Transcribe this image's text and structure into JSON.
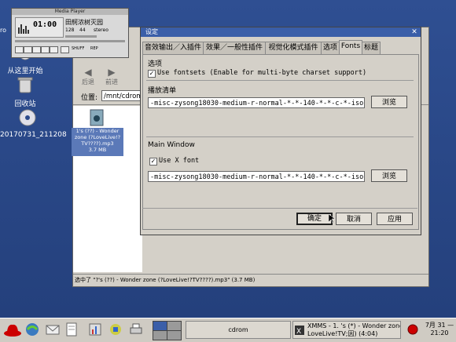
{
  "desktop": {
    "icons": [
      {
        "label": "从这里开始"
      },
      {
        "label": "回收站"
      },
      {
        "label": "20170731_211208"
      }
    ],
    "top_left_label": "ro"
  },
  "media_player": {
    "title": "Media Player",
    "time": "01:00",
    "track_text": "田舸浓树灭园",
    "kbps": "128",
    "khz": "44",
    "mode": "stereo",
    "shuffle": "SHUFF",
    "repeat": "REP"
  },
  "file_manager": {
    "back_label": "后退",
    "forward_label": "前进",
    "location_label": "位置:",
    "location_value": "/mnt/cdrom",
    "file_name": "1's (??) - Wonder zone (?LoveLive!?TV????).mp3",
    "file_size": "3.7 MB",
    "status_text": "选中了 \"?'s (??) - Wonder zone (?LoveLive!?TV????).mp3\" (3.7 MB)"
  },
  "dialog": {
    "title": "设定",
    "tabs": [
      {
        "label": "音效输出／入插件",
        "active": false
      },
      {
        "label": "效果／一般性插件",
        "active": false
      },
      {
        "label": "视觉化模式插件",
        "active": false
      },
      {
        "label": "选项",
        "active": false
      },
      {
        "label": "Fonts",
        "active": true
      },
      {
        "label": "标题",
        "active": false
      }
    ],
    "options_group": "选项",
    "use_fontsets_label": "Use fontsets (Enable for multi-byte charset support)",
    "use_fontsets_checked": true,
    "playlist_group": "播放清单",
    "playlist_font": "-misc-zysong18030-medium-r-normal-*-*-140-*-*-c-*-iso10646-1",
    "browse_label_1": "浏览",
    "main_window_group": "Main Window",
    "use_xfont_label": "Use X font",
    "use_xfont_checked": true,
    "main_font": "-misc-zysong18030-medium-r-normal-*-*-140-*-*-c-*-iso10646-1",
    "browse_label_2": "浏览",
    "ok_label": "确定",
    "cancel_label": "取消",
    "apply_label": "应用"
  },
  "taskbar": {
    "task_cdrom": "cdrom",
    "task_xmms_line1": "XMMS - 1. 's (*) - Wonder zone (",
    "task_xmms_line2": "LoveLive!TV;因) (4:04)",
    "date": "7月 31 —",
    "time": "21:20"
  }
}
